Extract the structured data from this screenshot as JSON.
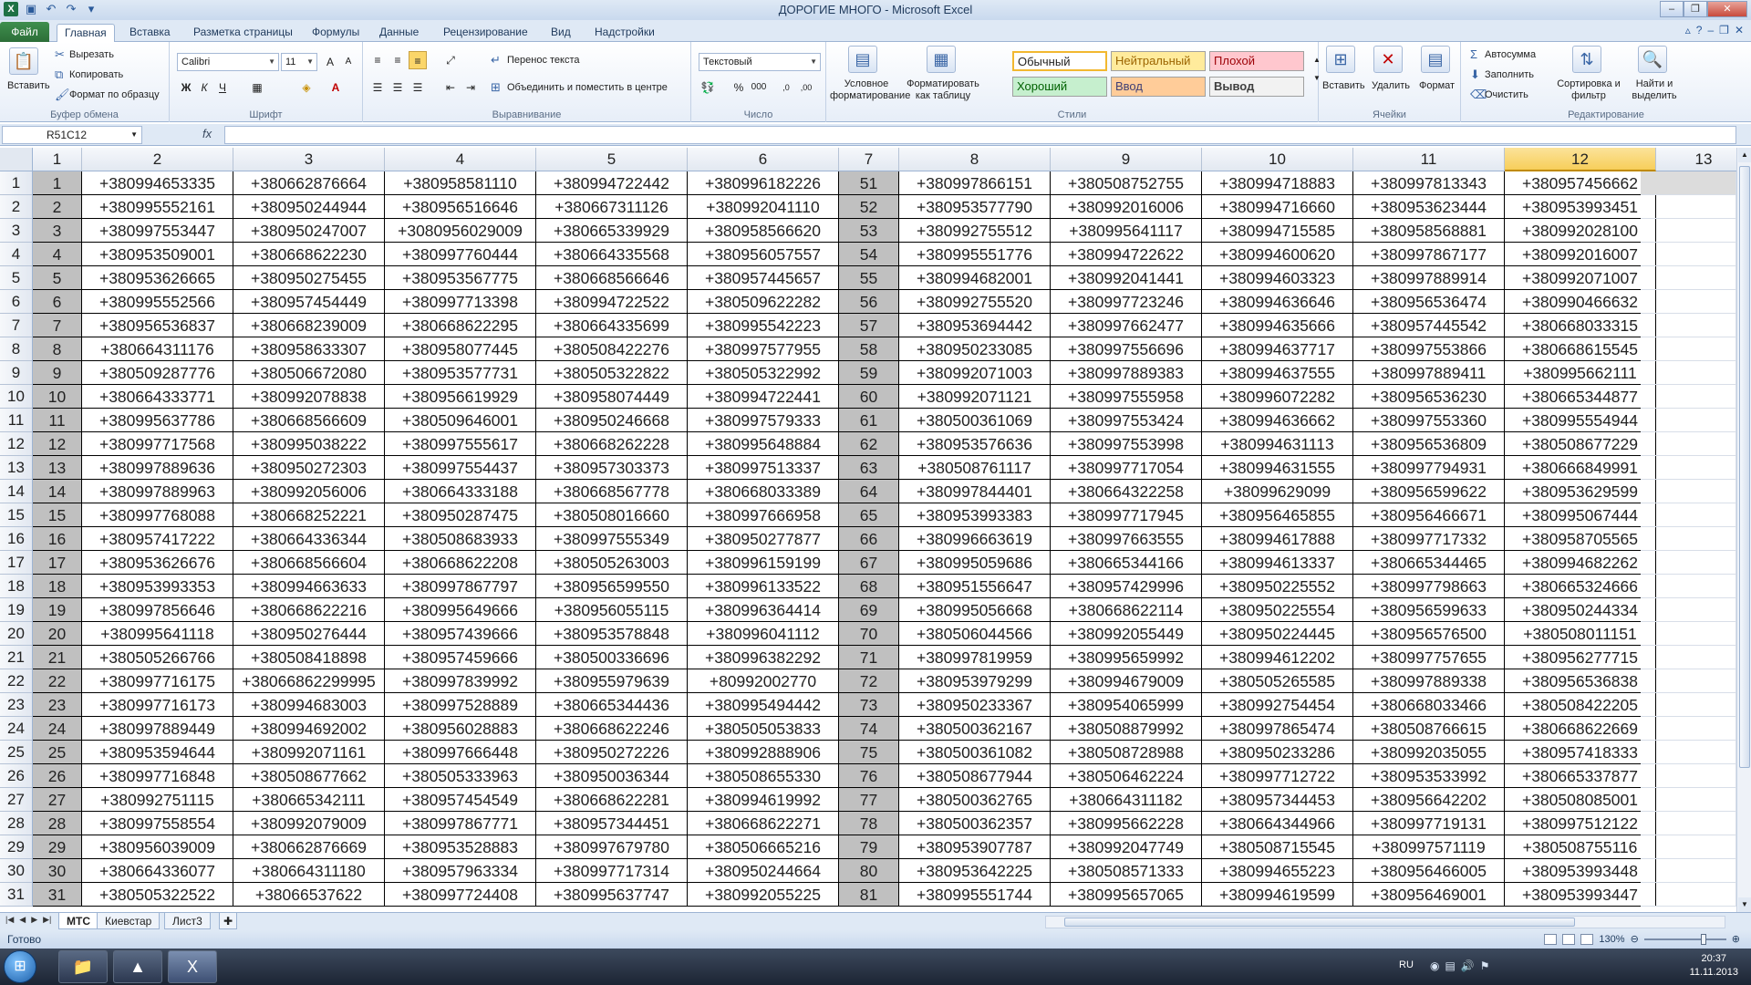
{
  "app": {
    "title": "ДОРОГИЕ МНОГО - Microsoft Excel",
    "file_tab": "Файл",
    "tabs": [
      "Главная",
      "Вставка",
      "Разметка страницы",
      "Формулы",
      "Данные",
      "Рецензирование",
      "Вид",
      "Надстройки"
    ]
  },
  "ribbon": {
    "clipboard": {
      "paste": "Вставить",
      "cut": "Вырезать",
      "copy": "Копировать",
      "format_painter": "Формат по образцу",
      "label": "Буфер обмена"
    },
    "font": {
      "name": "Calibri",
      "size": "11",
      "label": "Шрифт"
    },
    "alignment": {
      "wrap": "Перенос текста",
      "merge": "Объединить и поместить в центре",
      "label": "Выравнивание"
    },
    "number": {
      "format": "Текстовый",
      "label": "Число"
    },
    "styles": {
      "cond_format": "Условное форматирование",
      "as_table": "Форматировать как таблицу",
      "normal": "Обычный",
      "neutral": "Нейтральный",
      "bad": "Плохой",
      "good": "Хороший",
      "input": "Ввод",
      "output": "Вывод",
      "label": "Стили"
    },
    "cells": {
      "insert": "Вставить",
      "delete": "Удалить",
      "format": "Формат",
      "label": "Ячейки"
    },
    "editing": {
      "autosum": "Автосумма",
      "fill": "Заполнить",
      "clear": "Очистить",
      "sort": "Сортировка и фильтр",
      "find": "Найти и выделить",
      "label": "Редактирование"
    }
  },
  "formula_bar": {
    "name_box": "R51C12",
    "fx": "fx",
    "value": ""
  },
  "columns": [
    "1",
    "2",
    "3",
    "4",
    "5",
    "6",
    "7",
    "8",
    "9",
    "10",
    "11",
    "12",
    "13"
  ],
  "rows": [
    [
      "1",
      "+380994653335",
      "+380662876664",
      "+380958581110",
      "+380994722442",
      "+380996182226",
      "51",
      "+380997866151",
      "+380508752755",
      "+380994718883",
      "+380997813343",
      "+380957456662"
    ],
    [
      "2",
      "+380995552161",
      "+380950244944",
      "+380956516646",
      "+380667311126",
      "+380992041110",
      "52",
      "+380953577790",
      "+380992016006",
      "+380994716660",
      "+380953623444",
      "+380953993451"
    ],
    [
      "3",
      "+380997553447",
      "+380950247007",
      "+3080956029009",
      "+380665339929",
      "+380958566620",
      "53",
      "+380992755512",
      "+380995641117",
      "+380994715585",
      "+380958568881",
      "+380992028100"
    ],
    [
      "4",
      "+380953509001",
      "+380668622230",
      "+380997760444",
      "+380664335568",
      "+380956057557",
      "54",
      "+380995551776",
      "+380994722622",
      "+380994600620",
      "+380997867177",
      "+380992016007"
    ],
    [
      "5",
      "+380953626665",
      "+380950275455",
      "+380953567775",
      "+380668566646",
      "+380957445657",
      "55",
      "+380994682001",
      "+380992041441",
      "+380994603323",
      "+380997889914",
      "+380992071007"
    ],
    [
      "6",
      "+380995552566",
      "+380957454449",
      "+380997713398",
      "+380994722522",
      "+380509622282",
      "56",
      "+380992755520",
      "+380997723246",
      "+380994636646",
      "+380956536474",
      "+380990466632"
    ],
    [
      "7",
      "+380956536837",
      "+380668239009",
      "+380668622295",
      "+380664335699",
      "+380995542223",
      "57",
      "+380953694442",
      "+380997662477",
      "+380994635666",
      "+380957445542",
      "+380668033315"
    ],
    [
      "8",
      "+380664311176",
      "+380958633307",
      "+380958077445",
      "+380508422276",
      "+380997577955",
      "58",
      "+380950233085",
      "+380997556696",
      "+380994637717",
      "+380997553866",
      "+380668615545"
    ],
    [
      "9",
      "+380509287776",
      "+380506672080",
      "+380953577731",
      "+380505322822",
      "+380505322992",
      "59",
      "+380992071003",
      "+380997889383",
      "+380994637555",
      "+380997889411",
      "+380995662111"
    ],
    [
      "10",
      "+380664333771",
      "+380992078838",
      "+380956619929",
      "+380958074449",
      "+380994722441",
      "60",
      "+380992071121",
      "+380997555958",
      "+380996072282",
      "+380956536230",
      "+380665344877"
    ],
    [
      "11",
      "+380995637786",
      "+380668566609",
      "+380509646001",
      "+380950246668",
      "+380997579333",
      "61",
      "+380500361069",
      "+380997553424",
      "+380994636662",
      "+380997553360",
      "+380995554944"
    ],
    [
      "12",
      "+380997717568",
      "+380995038222",
      "+380997555617",
      "+380668262228",
      "+380995648884",
      "62",
      "+380953576636",
      "+380997553998",
      "+380994631113",
      "+380956536809",
      "+380508677229"
    ],
    [
      "13",
      "+380997889636",
      "+380950272303",
      "+380997554437",
      "+380957303373",
      "+380997513337",
      "63",
      "+380508761117",
      "+380997717054",
      "+380994631555",
      "+380997794931",
      "+380666849991"
    ],
    [
      "14",
      "+380997889963",
      "+380992056006",
      "+380664333188",
      "+380668567778",
      "+380668033389",
      "64",
      "+380997844401",
      "+380664322258",
      "+38099629099",
      "+380956599622",
      "+380953629599"
    ],
    [
      "15",
      "+380997768088",
      "+380668252221",
      "+380950287475",
      "+380508016660",
      "+380997666958",
      "65",
      "+380953993383",
      "+380997717945",
      "+380956465855",
      "+380956466671",
      "+380995067444"
    ],
    [
      "16",
      "+380957417222",
      "+380664336344",
      "+380508683933",
      "+380997555349",
      "+380950277877",
      "66",
      "+380996663619",
      "+380997663555",
      "+380994617888",
      "+380997717332",
      "+380958705565"
    ],
    [
      "17",
      "+380953626676",
      "+380668566604",
      "+380668622208",
      "+380505263003",
      "+380996159199",
      "67",
      "+380995059686",
      "+380665344166",
      "+380994613337",
      "+380665344465",
      "+380994682262"
    ],
    [
      "18",
      "+380953993353",
      "+380994663633",
      "+380997867797",
      "+380956599550",
      "+380996133522",
      "68",
      "+380951556647",
      "+380957429996",
      "+380950225552",
      "+380997798663",
      "+380665324666"
    ],
    [
      "19",
      "+380997856646",
      "+380668622216",
      "+380995649666",
      "+380956055115",
      "+380996364414",
      "69",
      "+380995056668",
      "+380668622114",
      "+380950225554",
      "+380956599633",
      "+380950244334"
    ],
    [
      "20",
      "+380995641118",
      "+380950276444",
      "+380957439666",
      "+380953578848",
      "+380996041112",
      "70",
      "+380506044566",
      "+380992055449",
      "+380950224445",
      "+380956576500",
      "+380508011151"
    ],
    [
      "21",
      "+380505266766",
      "+380508418898",
      "+380957459666",
      "+380500336696",
      "+380996382292",
      "71",
      "+380997819959",
      "+380995659992",
      "+380994612202",
      "+380997757655",
      "+380956277715"
    ],
    [
      "22",
      "+380997716175",
      "+38066862299995",
      "+380997839992",
      "+380955979639",
      "+80992002770",
      "72",
      "+380953979299",
      "+380994679009",
      "+380505265585",
      "+380997889338",
      "+380956536838"
    ],
    [
      "23",
      "+380997716173",
      "+380994683003",
      "+380997528889",
      "+380665344436",
      "+380995494442",
      "73",
      "+380950233367",
      "+380954065999",
      "+380992754454",
      "+380668033466",
      "+380508422205"
    ],
    [
      "24",
      "+380997889449",
      "+380994692002",
      "+380956028883",
      "+380668622246",
      "+380505053833",
      "74",
      "+380500362167",
      "+380508879992",
      "+380997865474",
      "+380508766615",
      "+380668622669"
    ],
    [
      "25",
      "+380953594644",
      "+380992071161",
      "+380997666448",
      "+380950272226",
      "+380992888906",
      "75",
      "+380500361082",
      "+380508728988",
      "+380950233286",
      "+380992035055",
      "+380957418333"
    ],
    [
      "26",
      "+380997716848",
      "+380508677662",
      "+380505333963",
      "+380950036344",
      "+380508655330",
      "76",
      "+380508677944",
      "+380506462224",
      "+380997712722",
      "+380953533992",
      "+380665337877"
    ],
    [
      "27",
      "+380992751115",
      "+380665342111",
      "+380957454549",
      "+380668622281",
      "+380994619992",
      "77",
      "+380500362765",
      "+380664311182",
      "+380957344453",
      "+380956642202",
      "+380508085001"
    ],
    [
      "28",
      "+380997558554",
      "+380992079009",
      "+380997867771",
      "+380957344451",
      "+380668622271",
      "78",
      "+380500362357",
      "+380995662228",
      "+380664344966",
      "+380997719131",
      "+380997512122"
    ],
    [
      "29",
      "+380956039009",
      "+380662876669",
      "+380953528883",
      "+380997679780",
      "+380506665216",
      "79",
      "+380953907787",
      "+380992047749",
      "+380508715545",
      "+380997571119",
      "+380508755116"
    ],
    [
      "30",
      "+380664336077",
      "+380664311180",
      "+380957963334",
      "+380997717314",
      "+380950244664",
      "80",
      "+380953642225",
      "+380508571333",
      "+380994655223",
      "+380956466005",
      "+380953993448"
    ],
    [
      "31",
      "+380505322522",
      "+38066537622",
      "+380997724408",
      "+380995637747",
      "+380992055225",
      "81",
      "+380995551744",
      "+380995657065",
      "+380994619599",
      "+380956469001",
      "+380953993447"
    ]
  ],
  "sheets": [
    "МТС",
    "Киевстар",
    "Лист3"
  ],
  "status": {
    "ready": "Готово",
    "zoom": "130%"
  },
  "taskbar": {
    "lang": "RU",
    "time": "20:37",
    "date": "11.11.2013"
  }
}
